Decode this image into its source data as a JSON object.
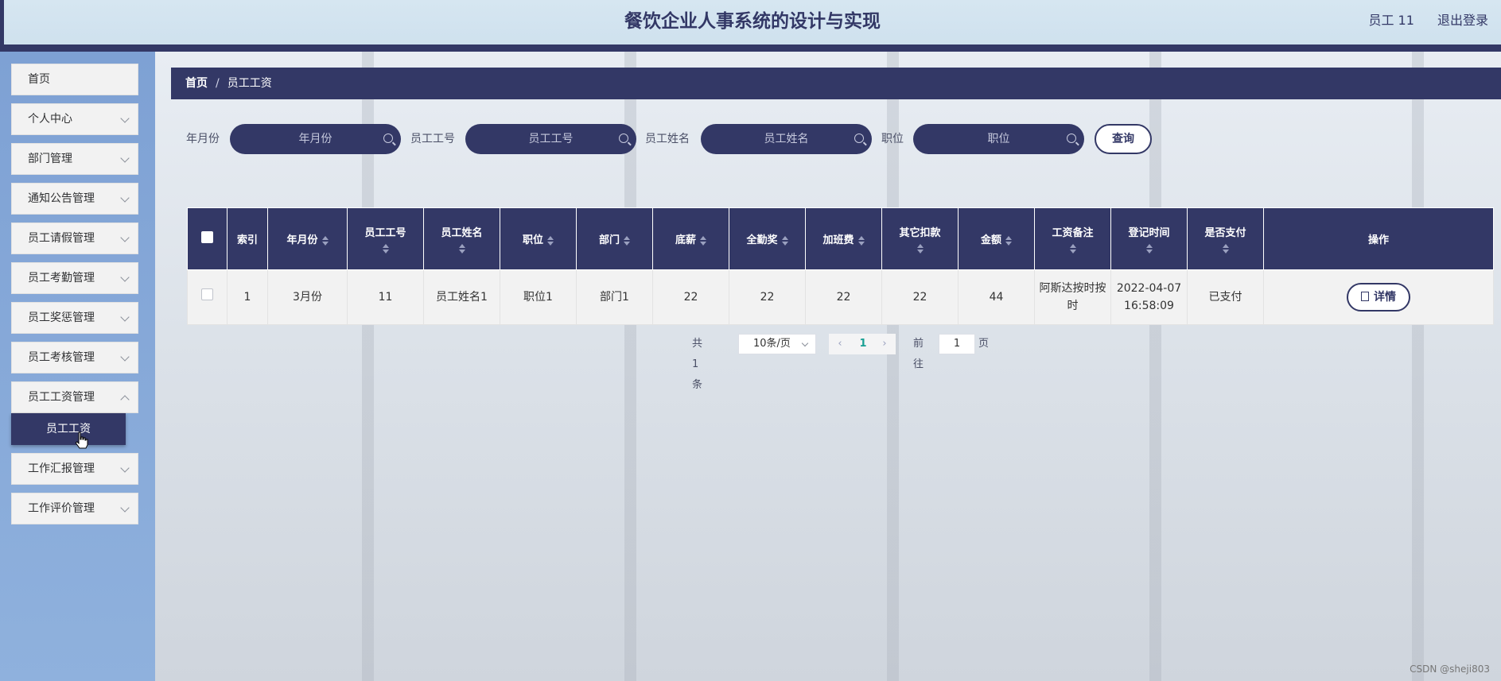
{
  "header": {
    "title": "餐饮企业人事系统的设计与实现",
    "user": "员工 11",
    "logout": "退出登录"
  },
  "sidebar": {
    "items": [
      {
        "label": "首页"
      },
      {
        "label": "个人中心"
      },
      {
        "label": "部门管理"
      },
      {
        "label": "通知公告管理"
      },
      {
        "label": "员工请假管理"
      },
      {
        "label": "员工考勤管理"
      },
      {
        "label": "员工奖惩管理"
      },
      {
        "label": "员工考核管理"
      },
      {
        "label": "员工工资管理"
      },
      {
        "label": "工作汇报管理"
      },
      {
        "label": "工作评价管理"
      }
    ],
    "active_sub": "员工工资"
  },
  "breadcrumb": {
    "home": "首页",
    "sep": "/",
    "current": "员工工资"
  },
  "search": {
    "month_label": "年月份",
    "month_placeholder": "年月份",
    "empno_label": "员工工号",
    "empno_placeholder": "员工工号",
    "name_label": "员工姓名",
    "name_placeholder": "员工姓名",
    "position_label": "职位",
    "position_placeholder": "职位",
    "query": "查询"
  },
  "table": {
    "headers": [
      "索引",
      "年月份",
      "员工工号",
      "员工姓名",
      "职位",
      "部门",
      "底薪",
      "全勤奖",
      "加班费",
      "其它扣款",
      "金额",
      "工资备注",
      "登记时间",
      "是否支付",
      "操作"
    ],
    "rows": [
      {
        "index": "1",
        "month": "3月份",
        "empno": "11",
        "name": "员工姓名1",
        "position": "职位1",
        "dept": "部门1",
        "base": "22",
        "attendance": "22",
        "overtime": "22",
        "deduction": "22",
        "amount": "44",
        "remark": "阿斯达按时按时",
        "time": "2022-04-07 16:58:09",
        "paid": "已支付",
        "action": "详情"
      }
    ]
  },
  "pagination": {
    "total": "共 1 条",
    "page_size": "10条/页",
    "current": "1",
    "goto": "前往",
    "goto_value": "1",
    "page_unit": "页",
    "prev": "‹",
    "next": "›"
  },
  "watermark": "CSDN @sheji803"
}
